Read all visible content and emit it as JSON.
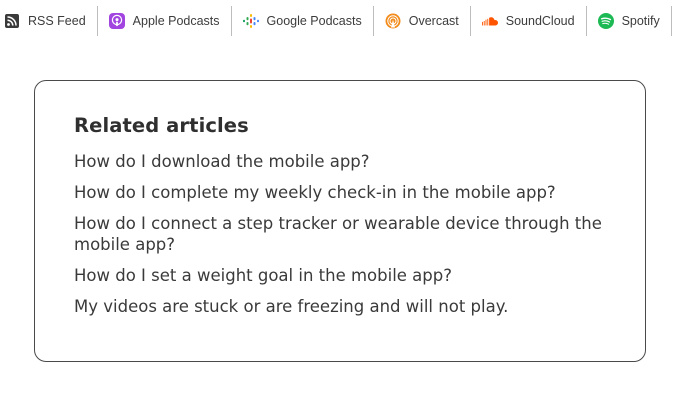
{
  "podcast_links": [
    {
      "label": "RSS Feed",
      "icon": "rss-icon"
    },
    {
      "label": "Apple Podcasts",
      "icon": "apple-podcasts-icon",
      "color": "#9b3fdc"
    },
    {
      "label": "Google Podcasts",
      "icon": "google-podcasts-icon"
    },
    {
      "label": "Overcast",
      "icon": "overcast-icon",
      "color": "#f28b1a"
    },
    {
      "label": "SoundCloud",
      "icon": "soundcloud-icon",
      "color": "#ff5500"
    },
    {
      "label": "Spotify",
      "icon": "spotify-icon",
      "color": "#1db954"
    }
  ],
  "related": {
    "title": "Related articles",
    "articles": [
      "How do I download the mobile app?",
      "How do I complete my weekly check-in in the mobile app?",
      "How do I connect a step tracker or wearable device through the mobile app?",
      "How do I set a weight goal in the mobile app?",
      "My videos are stuck or are freezing and will not play."
    ]
  }
}
